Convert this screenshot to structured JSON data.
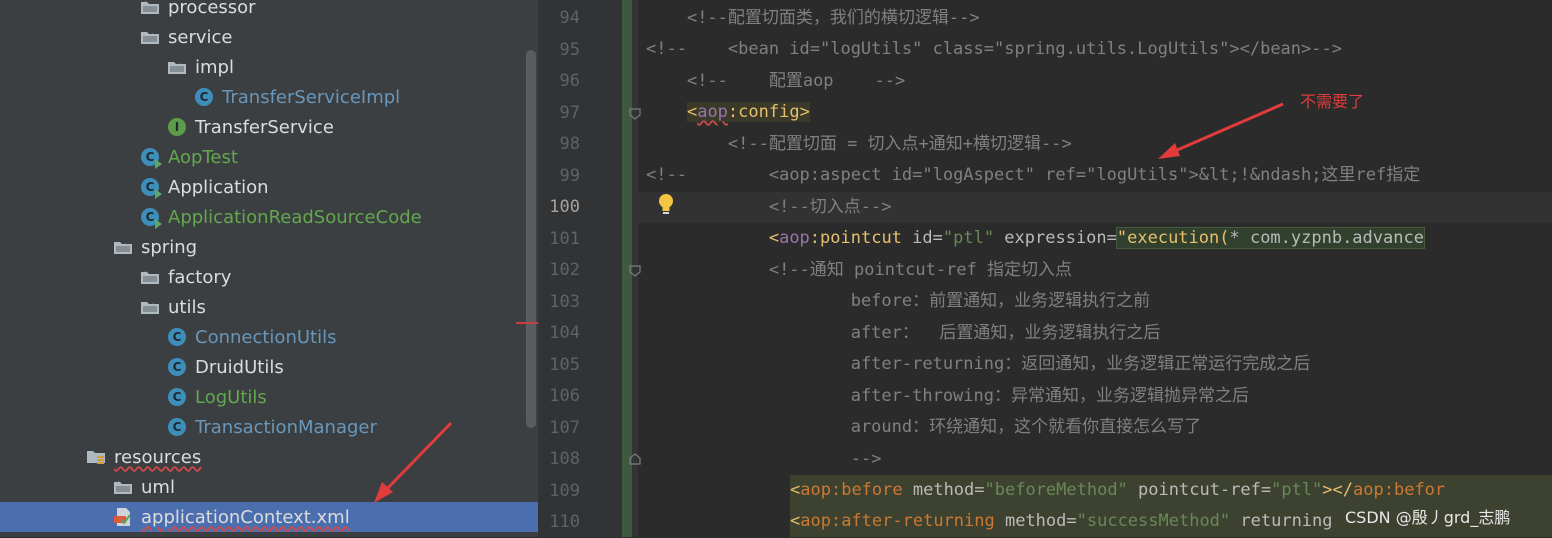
{
  "colors": {
    "tree_bg": "#3c3f41",
    "selection": "#4b6eaf",
    "editor_bg": "#2b2b2b",
    "annotation": "#e23b3b"
  },
  "tree": {
    "rows": [
      {
        "label": "processor",
        "icon": "folder-icon",
        "expanded": false,
        "color": "white"
      },
      {
        "label": "service",
        "icon": "folder-icon",
        "expanded": true,
        "color": "white"
      },
      {
        "label": "impl",
        "icon": "folder-icon",
        "expanded": true,
        "color": "white"
      },
      {
        "label": "TransferServiceImpl",
        "icon": "class-icon",
        "color": "blue"
      },
      {
        "label": "TransferService",
        "icon": "interface-icon",
        "color": "white"
      },
      {
        "label": "AopTest",
        "icon": "runnable-class-icon",
        "color": "green"
      },
      {
        "label": "Application",
        "icon": "runnable-class-icon",
        "color": "white"
      },
      {
        "label": "ApplicationReadSourceCode",
        "icon": "runnable-class-icon",
        "color": "green"
      },
      {
        "label": "spring",
        "icon": "folder-icon",
        "expanded": true,
        "color": "white"
      },
      {
        "label": "factory",
        "icon": "folder-icon",
        "expanded": false,
        "color": "white"
      },
      {
        "label": "utils",
        "icon": "folder-icon",
        "expanded": true,
        "color": "white"
      },
      {
        "label": "ConnectionUtils",
        "icon": "class-icon",
        "color": "blue"
      },
      {
        "label": "DruidUtils",
        "icon": "class-icon",
        "color": "white"
      },
      {
        "label": "LogUtils",
        "icon": "class-icon",
        "color": "green"
      },
      {
        "label": "TransactionManager",
        "icon": "class-icon",
        "color": "blue"
      },
      {
        "label": "resources",
        "icon": "resources-folder-icon",
        "expanded": true,
        "color": "white"
      },
      {
        "label": "uml",
        "icon": "folder-icon",
        "expanded": false,
        "color": "white"
      },
      {
        "label": "applicationContext.xml",
        "icon": "xml-file-icon",
        "color": "white",
        "selected": true
      }
    ]
  },
  "editor": {
    "line_numbers": [
      "94",
      "95",
      "96",
      "97",
      "98",
      "99",
      "100",
      "101",
      "102",
      "103",
      "104",
      "105",
      "106",
      "107",
      "108",
      "109",
      "110"
    ],
    "current_line": "100",
    "lines": {
      "l94": "<!--配置切面类，我们的横切逻辑-->",
      "l95": "<!--    <bean id=\"logUtils\" class=\"spring.utils.LogUtils\"></bean>-->",
      "l96": "<!--    配置aop    -->",
      "l97_open": "<",
      "l97_ns": "aop",
      "l97_tag": ":config",
      "l97_close": ">",
      "l98": "<!--配置切面 = 切入点+通知+横切逻辑-->",
      "l99_prefix": "<!--",
      "l99_rest": "<aop:aspect id=\"logAspect\" ref=\"logUtils\">&lt;!&ndash;这里ref指定",
      "l100": "<!--切入点-->",
      "l101_open": "<",
      "l101_ns": "aop",
      "l101_tag": ":pointcut",
      "l101_attr1": " id=",
      "l101_val1": "\"ptl\"",
      "l101_attr2": " expression=",
      "l101_val2": "\"execution(",
      "l101_rest": "* com.yzpnb.advance",
      "l102": "<!--通知 pointcut-ref 指定切入点",
      "l103": "before：前置通知，业务逻辑执行之前",
      "l104": "after：  后置通知，业务逻辑执行之后",
      "l105": "after-returning：返回通知，业务逻辑正常运行完成之后",
      "l106": "after-throwing：异常通知，业务逻辑抛异常之后",
      "l107": "around：环绕通知，这个就看你直接怎么写了",
      "l108": "-->",
      "l109_open": "<",
      "l109_ns": "aop",
      "l109_tag": ":before",
      "l109_attr1": " method=",
      "l109_val1": "\"beforeMethod\"",
      "l109_attr2": " pointcut-ref=",
      "l109_val2": "\"ptl\"",
      "l109_end": "></",
      "l109_ns2": "aop",
      "l109_tag2": ":befor",
      "l110_open": "<",
      "l110_ns": "aop",
      "l110_tag": ":after-returning",
      "l110_attr1": " method=",
      "l110_val1": "\"successMethod\"",
      "l110_attr2": " returning"
    }
  },
  "annotation": {
    "text": "不需要了"
  },
  "watermark": "CSDN @殷丿grd_志鹏"
}
